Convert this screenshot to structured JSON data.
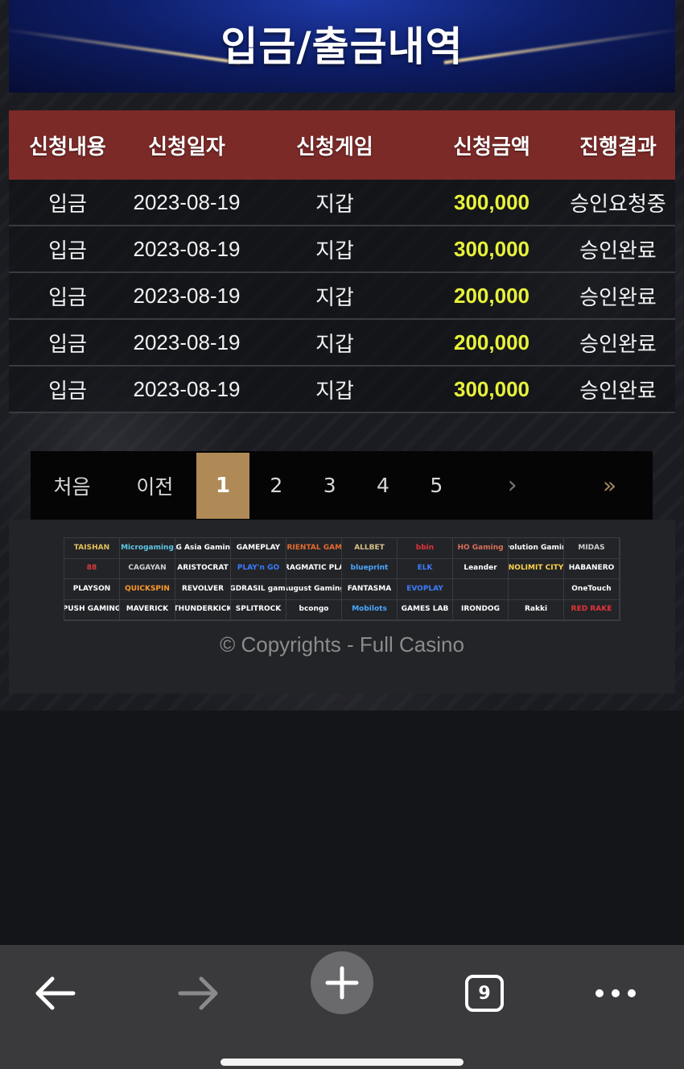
{
  "header": {
    "title": "입금/출금내역"
  },
  "table": {
    "columns": [
      "신청내용",
      "신청일자",
      "신청게임",
      "신청금액",
      "진행결과"
    ],
    "rows": [
      [
        "입금",
        "2023-08-19",
        "지갑",
        "300,000",
        "승인요청중"
      ],
      [
        "입금",
        "2023-08-19",
        "지갑",
        "300,000",
        "승인완료"
      ],
      [
        "입금",
        "2023-08-19",
        "지갑",
        "200,000",
        "승인완료"
      ],
      [
        "입금",
        "2023-08-19",
        "지갑",
        "200,000",
        "승인완료"
      ],
      [
        "입금",
        "2023-08-19",
        "지갑",
        "300,000",
        "승인완료"
      ]
    ]
  },
  "pagination": {
    "first": "처음",
    "prev": "이전",
    "pages": [
      "1",
      "2",
      "3",
      "4",
      "5"
    ],
    "active_page": "1",
    "next": "›",
    "last": "»"
  },
  "footer": {
    "providers": [
      "TAISHAN",
      "Microgaming",
      "AG Asia Gaming",
      "GAMEPLAY",
      "ORIENTAL GAME",
      "ALLBET",
      "bbin",
      "HO Gaming",
      "Evolution Gaming",
      "MIDAS",
      "88",
      "CAGAYAN",
      "ARISTOCRAT",
      "PLAY'n GO",
      "PRAGMATIC PLAY",
      "blueprint",
      "ELK",
      "Leander",
      "NOLIMIT CITY",
      "HABANERO",
      "PLAYSON",
      "QUICKSPIN",
      "REVOLVER",
      "YGGDRASIL gaming",
      "August Gaming",
      "FANTASMA",
      "EVOPLAY",
      "",
      "",
      "OneTouch",
      "PUSH GAMING",
      "MAVERICK",
      "THUNDERKICK",
      "SPLITROCK",
      "bcongo",
      "Mobilots",
      "GAMES LAB",
      "IRONDOG",
      "Rakki",
      "RED RAKE"
    ],
    "copyright": "© Copyrights - Full Casino"
  },
  "browser_bar": {
    "back_icon": "arrow-left-icon",
    "forward_icon": "arrow-right-icon",
    "new_tab_icon": "plus-icon",
    "tab_count": "9",
    "more_icon": "more-dots-icon"
  },
  "colors": {
    "header_bg": "#0e1f6b",
    "table_header_bg": "#7b2a28",
    "amount_color": "#e8f23a",
    "active_page_bg": "#b08a56"
  }
}
